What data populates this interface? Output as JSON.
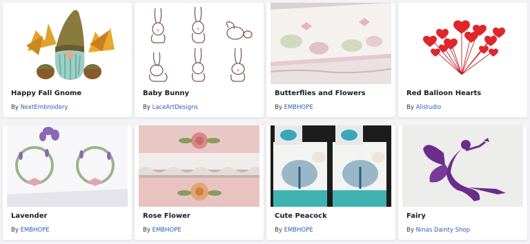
{
  "by_prefix": "By",
  "cards": [
    {
      "title": "Happy Fall Gnome",
      "author": "NextEmbroidery",
      "thumb_icon": "gnome-embroidery-image"
    },
    {
      "title": "Baby Bunny",
      "author": "LaceArtDesigns",
      "thumb_icon": "bunny-embroidery-image"
    },
    {
      "title": "Butterflies and Flowers",
      "author": "EMBHOPE",
      "thumb_icon": "butterfly-towel-image"
    },
    {
      "title": "Red Balloon Hearts",
      "author": "Alistudio",
      "thumb_icon": "hearts-embroidery-image"
    },
    {
      "title": "Lavender",
      "author": "EMBHOPE",
      "thumb_icon": "lavender-towel-image"
    },
    {
      "title": "Rose Flower",
      "author": "EMBHOPE",
      "thumb_icon": "rose-towel-image"
    },
    {
      "title": "Cute Peacock",
      "author": "EMBHOPE",
      "thumb_icon": "peacock-towel-image"
    },
    {
      "title": "Fairy",
      "author": "Ninas Dainty Shop",
      "thumb_icon": "fairy-embroidery-image"
    }
  ],
  "colors": {
    "link": "#2a5db0",
    "title": "#1c1c28",
    "heart_red": "#e0262b",
    "fairy_purple": "#6a2d8c"
  }
}
